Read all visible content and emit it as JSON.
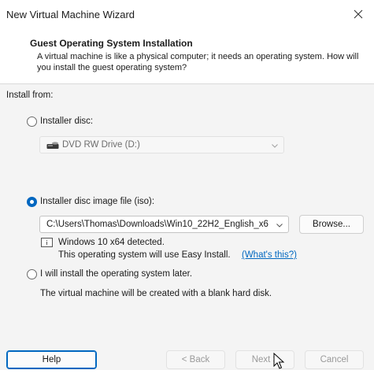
{
  "window": {
    "title": "New Virtual Machine Wizard"
  },
  "header": {
    "title": "Guest Operating System Installation",
    "description": "A virtual machine is like a physical computer; it needs an operating system. How will you install the guest operating system?"
  },
  "install_from": {
    "label": "Install from:",
    "installer_disc": {
      "label": "Installer disc:",
      "drive": "DVD RW Drive (D:)",
      "selected": false
    },
    "iso": {
      "label": "Installer disc image file (iso):",
      "path": "C:\\Users\\Thomas\\Downloads\\Win10_22H2_English_x6",
      "browse_label": "Browse...",
      "selected": true,
      "detected": "Windows 10 x64 detected.",
      "easy_install_text": "This operating system will use Easy Install.",
      "whats_this": "(What's this?)"
    },
    "later": {
      "label": "I will install the operating system later.",
      "description": "The virtual machine will be created with a blank hard disk.",
      "selected": false
    }
  },
  "buttons": {
    "help": "Help",
    "back": "< Back",
    "next": "Next >",
    "cancel": "Cancel"
  },
  "colors": {
    "accent": "#0067c0",
    "link": "#0067c0"
  }
}
